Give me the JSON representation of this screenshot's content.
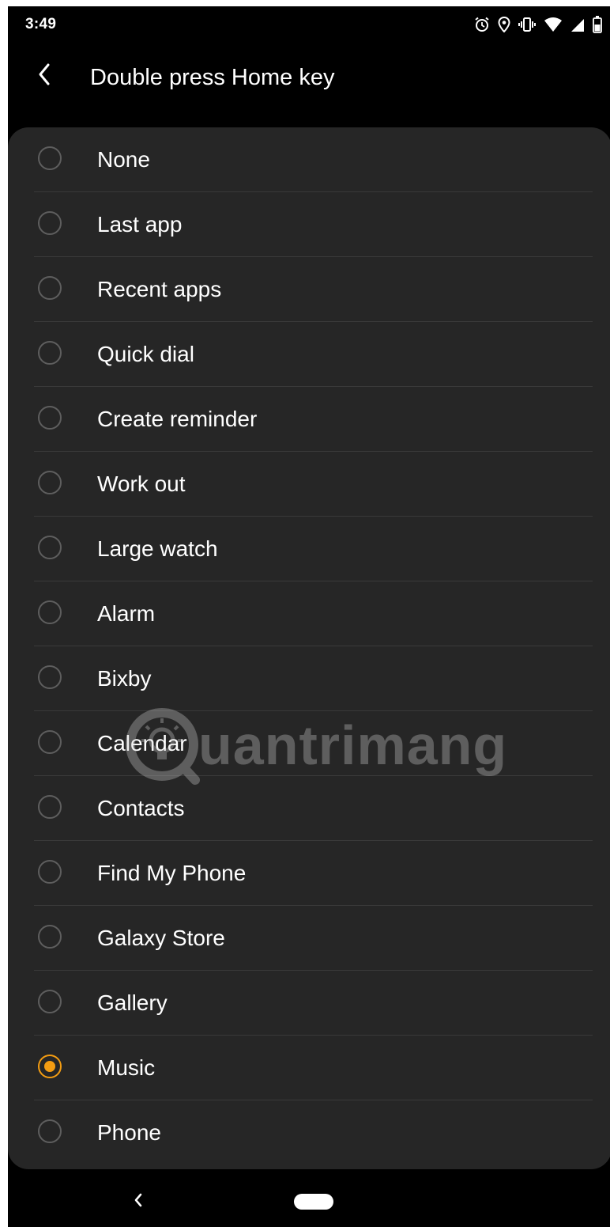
{
  "status_bar": {
    "time": "3:49",
    "icons": [
      "alarm-icon",
      "location-icon",
      "vibrate-icon",
      "wifi-icon",
      "signal-icon",
      "battery-icon"
    ]
  },
  "header": {
    "back_icon": "chevron-left-icon",
    "title": "Double press Home key"
  },
  "options": [
    {
      "label": "None",
      "selected": false
    },
    {
      "label": "Last app",
      "selected": false
    },
    {
      "label": "Recent apps",
      "selected": false
    },
    {
      "label": "Quick dial",
      "selected": false
    },
    {
      "label": "Create reminder",
      "selected": false
    },
    {
      "label": "Work out",
      "selected": false
    },
    {
      "label": "Large watch",
      "selected": false
    },
    {
      "label": "Alarm",
      "selected": false
    },
    {
      "label": "Bixby",
      "selected": false
    },
    {
      "label": "Calendar",
      "selected": false
    },
    {
      "label": "Contacts",
      "selected": false
    },
    {
      "label": "Find My Phone",
      "selected": false
    },
    {
      "label": "Galaxy Store",
      "selected": false
    },
    {
      "label": "Gallery",
      "selected": false
    },
    {
      "label": "Music",
      "selected": true
    },
    {
      "label": "Phone",
      "selected": false
    }
  ],
  "watermark": {
    "text": "uantrimang"
  },
  "nav_bar": {
    "back_icon": "nav-back-icon",
    "home_icon": "home-pill-icon"
  },
  "colors": {
    "background": "#000000",
    "card": "#262626",
    "accent": "#f39c12",
    "text": "#ffffff",
    "radio_border": "#5e5e5e",
    "divider": "#3a3a3a"
  }
}
